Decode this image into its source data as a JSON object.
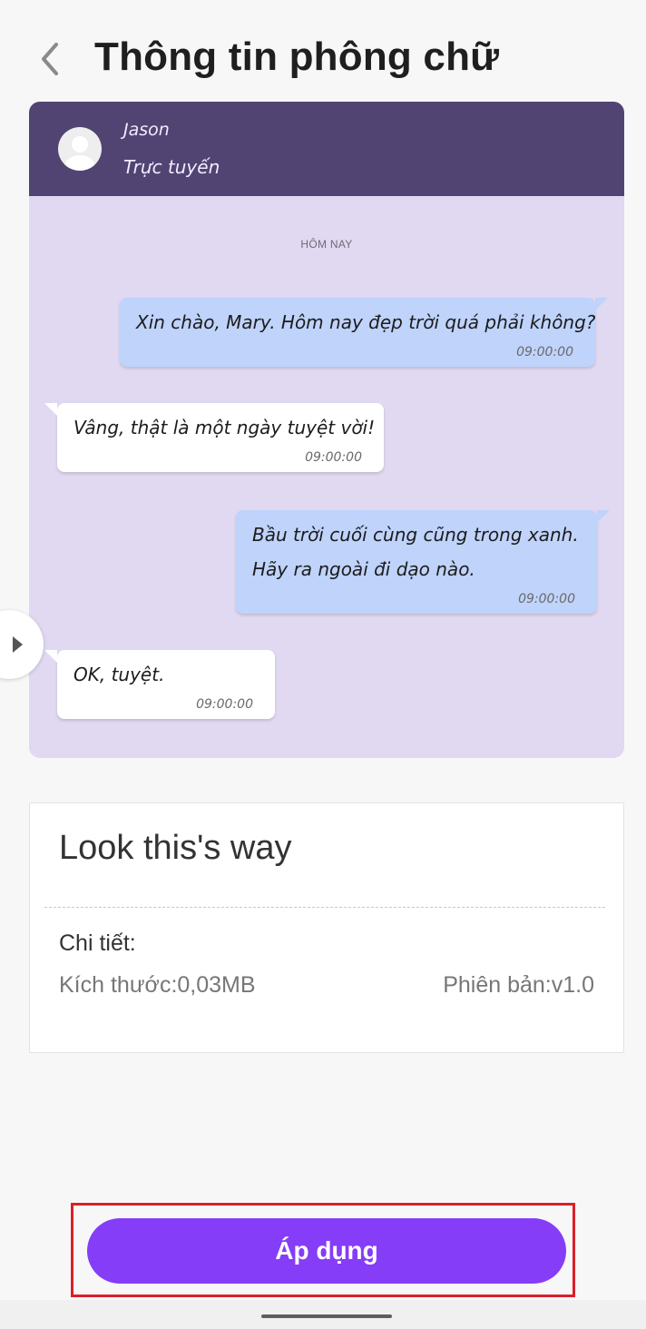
{
  "header": {
    "title": "Thông tin phông chữ",
    "back_icon": "chevron-left-icon"
  },
  "preview": {
    "contact_name": "Jason",
    "contact_status": "Trực tuyến",
    "date_label": "HÔM NAY",
    "messages": [
      {
        "direction": "out",
        "lines": [
          "Xin chào, Mary. Hôm nay đẹp trời quá phải không?"
        ],
        "time": "09:00:00"
      },
      {
        "direction": "in",
        "lines": [
          "Vâng, thật là một ngày tuyệt vời!"
        ],
        "time": "09:00:00"
      },
      {
        "direction": "out",
        "lines": [
          "Bầu trời cuối cùng cũng trong xanh.",
          "Hãy ra ngoài đi dạo nào."
        ],
        "time": "09:00:00"
      },
      {
        "direction": "in",
        "lines": [
          "OK, tuyệt."
        ],
        "time": "09:00:00"
      }
    ],
    "colors": {
      "chat_header": "#514472",
      "chat_background": "#e0d9f1",
      "outgoing_bubble": "#bfd3fb",
      "incoming_bubble": "#ffffff"
    }
  },
  "info": {
    "font_name": "Look this's way",
    "details_label": "Chi tiết:",
    "size": "Kích thước:0,03MB",
    "version": "Phiên bản:v1.0"
  },
  "actions": {
    "apply_label": "Áp dụng",
    "apply_color": "#853df8",
    "highlight_color": "#d9202a"
  }
}
